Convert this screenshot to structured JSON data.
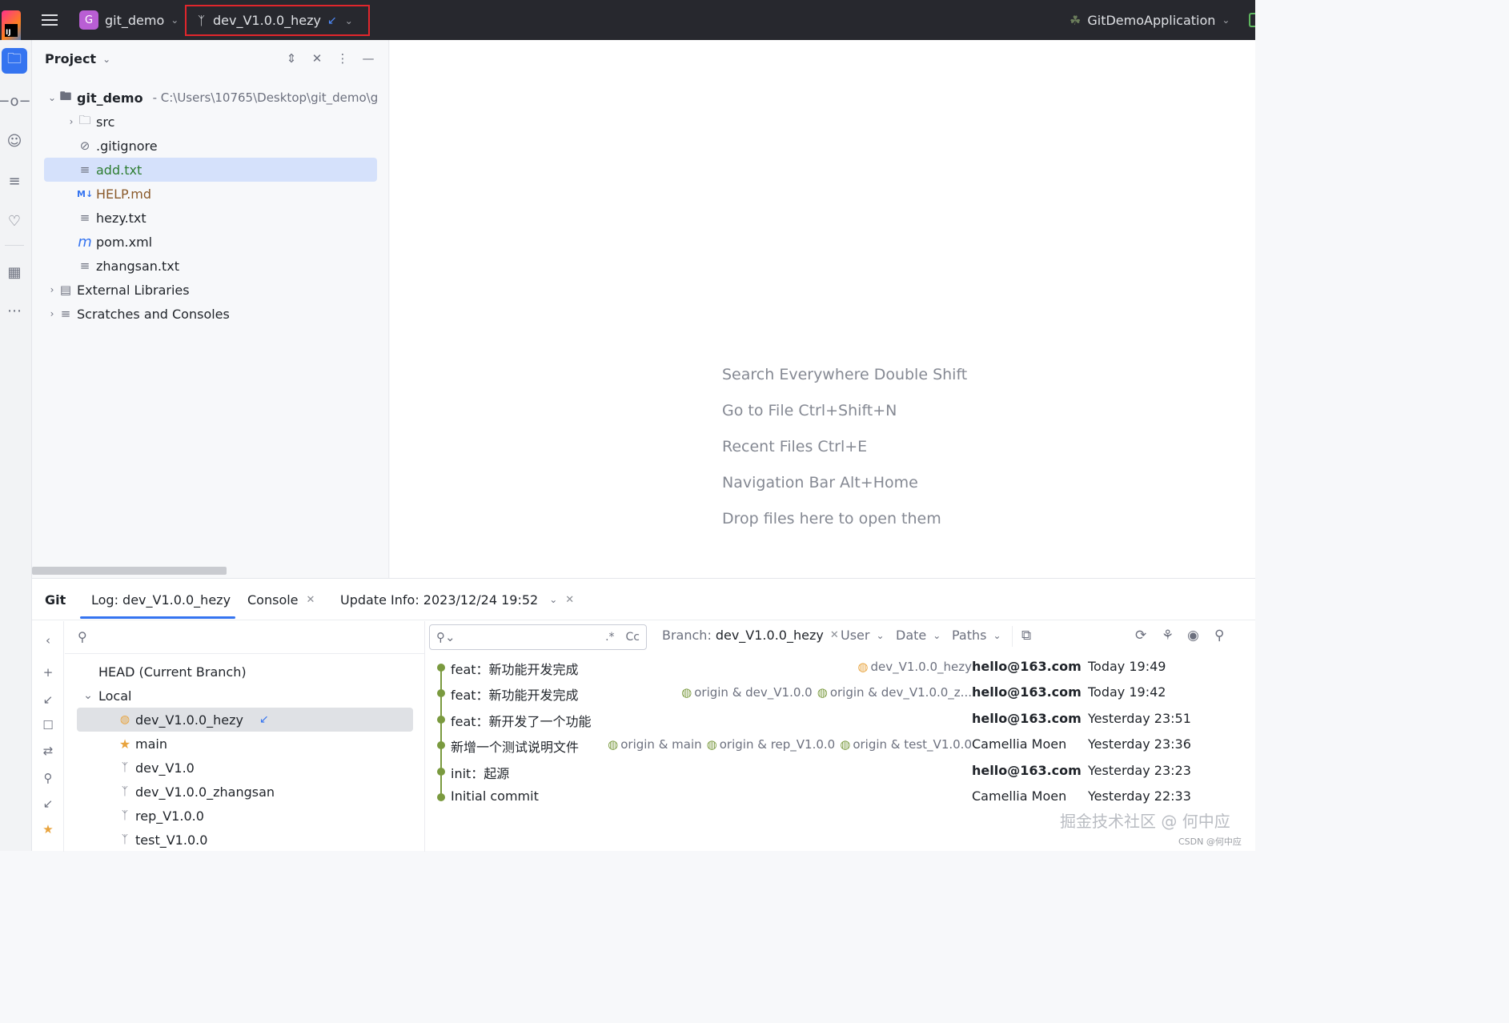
{
  "titlebar": {
    "app_logo_text": "IJ",
    "project_initial": "G",
    "project_name": "git_demo",
    "branch_name": "dev_V1.0.0_hezy",
    "run_config": "GitDemoApplication"
  },
  "project_panel": {
    "title": "Project",
    "tree": [
      {
        "label": "git_demo",
        "hint": "- C:\\Users\\10765\\Desktop\\git_demo\\g"
      },
      {
        "label": "src"
      },
      {
        "label": ".gitignore"
      },
      {
        "label": "add.txt",
        "color": "#2e7d32"
      },
      {
        "label": "HELP.md",
        "color": "#8a5a2b"
      },
      {
        "label": "hezy.txt"
      },
      {
        "label": "pom.xml"
      },
      {
        "label": "zhangsan.txt"
      },
      {
        "label": "External Libraries"
      },
      {
        "label": "Scratches and Consoles"
      }
    ]
  },
  "editor_hints": [
    "Search Everywhere Double Shift",
    "Go to File Ctrl+Shift+N",
    "Recent Files Ctrl+E",
    "Navigation Bar Alt+Home",
    "Drop files here to open them"
  ],
  "git_window": {
    "tabs": [
      "Git",
      "Log: dev_V1.0.0_hezy",
      "Console",
      "Update Info: 2023/12/24 19:52"
    ],
    "branches": {
      "head": "HEAD (Current Branch)",
      "local_label": "Local",
      "local": [
        "dev_V1.0.0_hezy",
        "main",
        "dev_V1.0",
        "dev_V1.0.0_zhangsan",
        "rep_V1.0.0",
        "test_V1.0.0"
      ]
    },
    "log_filters": {
      "search_regex": ".*",
      "search_case": "Cc",
      "branch_label": "Branch:",
      "branch_value": "dev_V1.0.0_hezy",
      "user": "User",
      "date": "Date",
      "paths": "Paths"
    },
    "commits": [
      {
        "message": "feat：新功能开发完成",
        "refs": [
          "dev_V1.0.0_hezy"
        ],
        "author": "hello@163.com",
        "date": "Today 19:49"
      },
      {
        "message": "feat：新功能开发完成",
        "refs": [
          "origin & dev_V1.0.0",
          "origin & dev_V1.0.0_z..."
        ],
        "author": "hello@163.com",
        "date": "Today 19:42"
      },
      {
        "message": "feat：新开发了一个功能",
        "refs": [],
        "author": "hello@163.com",
        "date": "Yesterday 23:51"
      },
      {
        "message": "新增一个测试说明文件",
        "refs": [
          "origin & main",
          "origin & rep_V1.0.0",
          "origin & test_V1.0.0"
        ],
        "author": "Camellia Moen",
        "date": "Yesterday 23:36"
      },
      {
        "message": "init：起源",
        "refs": [],
        "author": "hello@163.com",
        "date": "Yesterday 23:23"
      },
      {
        "message": "Initial commit",
        "refs": [],
        "author": "Camellia Moen",
        "date": "Yesterday 22:33"
      }
    ]
  },
  "watermark": "掘金技术社区 @ 何中应",
  "watermark_small": "CSDN @何中应"
}
